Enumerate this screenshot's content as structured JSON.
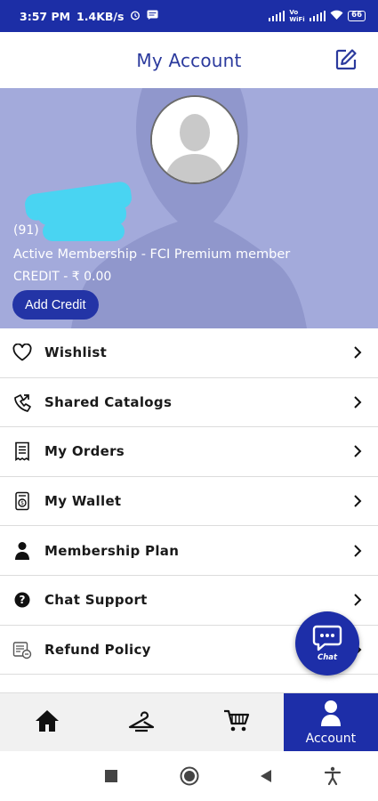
{
  "status_bar": {
    "time": "3:57 PM",
    "speed": "1.4KB/s",
    "net_label": "Vo\nWiFi",
    "battery": "66"
  },
  "header": {
    "title": "My Account"
  },
  "profile": {
    "phone_prefix": "(91)",
    "membership": "Active Membership - FCI Premium member",
    "credit": "CREDIT - ₹ 0.00",
    "add_credit_label": "Add Credit"
  },
  "menu": {
    "items": [
      {
        "label": "Wishlist",
        "icon": "heart-icon"
      },
      {
        "label": "Shared Catalogs",
        "icon": "share-icon"
      },
      {
        "label": "My Orders",
        "icon": "receipt-icon"
      },
      {
        "label": "My Wallet",
        "icon": "wallet-icon"
      },
      {
        "label": "Membership Plan",
        "icon": "person-icon"
      },
      {
        "label": "Chat Support",
        "icon": "help-icon"
      },
      {
        "label": "Refund Policy",
        "icon": "refund-icon"
      }
    ]
  },
  "chat_fab": {
    "label": "Chat"
  },
  "bottom_nav": {
    "items": [
      {
        "icon": "home-icon",
        "label": ""
      },
      {
        "icon": "hanger-icon",
        "label": ""
      },
      {
        "icon": "cart-icon",
        "label": ""
      },
      {
        "icon": "account-icon",
        "label": "Account",
        "active": true
      }
    ]
  },
  "colors": {
    "primary": "#1d2ea8",
    "banner": "#a3aadb",
    "title": "#2b3a9d"
  }
}
